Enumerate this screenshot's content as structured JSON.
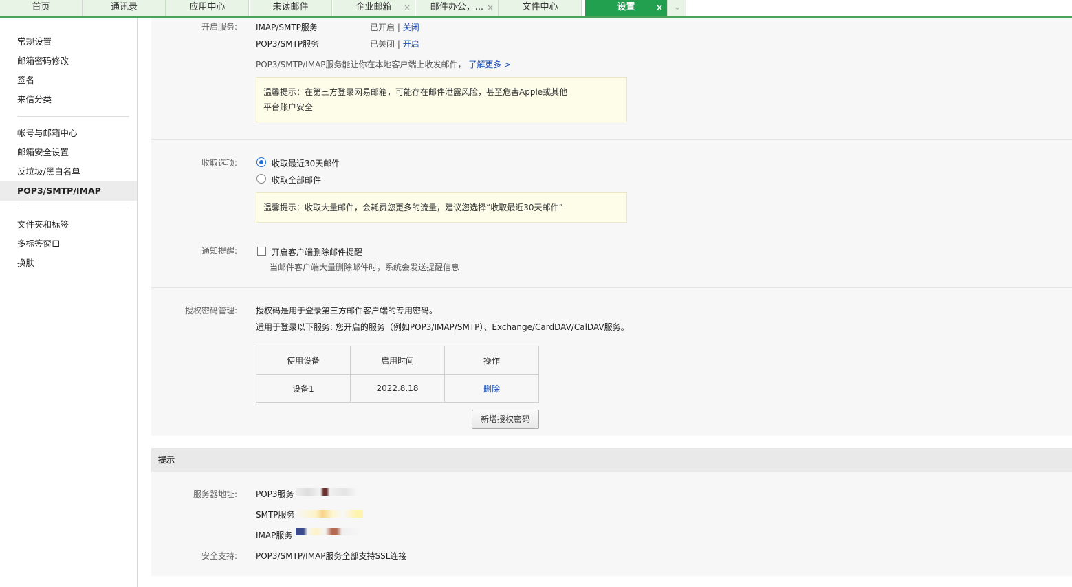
{
  "tabs": [
    {
      "label": "首页",
      "closable": false,
      "active": false
    },
    {
      "label": "通讯录",
      "closable": false,
      "active": false
    },
    {
      "label": "应用中心",
      "closable": false,
      "active": false
    },
    {
      "label": "未读邮件",
      "closable": false,
      "active": false
    },
    {
      "label": "企业邮箱",
      "closable": true,
      "active": false
    },
    {
      "label": "邮件办公，...",
      "closable": true,
      "active": false
    },
    {
      "label": "文件中心",
      "closable": false,
      "active": false
    },
    {
      "label": "设置",
      "closable": true,
      "active": true
    }
  ],
  "tab_close_glyph": "×",
  "tab_more_glyph": "⌄",
  "sidebar": {
    "groups": [
      [
        "常规设置",
        "邮箱密码修改",
        "签名",
        "来信分类"
      ],
      [
        "帐号与邮箱中心",
        "邮箱安全设置",
        "反垃圾/黑白名单",
        "POP3/SMTP/IMAP"
      ],
      [
        "文件夹和标签",
        "多标签窗口",
        "换肤"
      ]
    ],
    "active": "POP3/SMTP/IMAP"
  },
  "services": {
    "label": "开启服务:",
    "rows": [
      {
        "name": "IMAP/SMTP服务",
        "status": "已开启",
        "sep": "|",
        "action": "关闭"
      },
      {
        "name": "POP3/SMTP服务",
        "status": "已关闭",
        "sep": "|",
        "action": "开启"
      }
    ],
    "note": "POP3/SMTP/IMAP服务能让你在本地客户端上收发邮件，",
    "learn_more": "了解更多 >",
    "tip": "温馨提示：在第三方登录网易邮箱，可能存在邮件泄露风险，甚至危害Apple或其他平台账户安全"
  },
  "receive": {
    "label": "收取选项:",
    "options": [
      "收取最近30天邮件",
      "收取全部邮件"
    ],
    "selected": 0,
    "tip": "温馨提示：收取大量邮件，会耗费您更多的流量，建议您选择“收取最近30天邮件”"
  },
  "notify": {
    "label": "通知提醒:",
    "checkbox_label": "开启客户端删除邮件提醒",
    "checked": false,
    "desc": "当邮件客户端大量删除邮件时，系统会发送提醒信息"
  },
  "auth": {
    "label": "授权密码管理:",
    "line1": "授权码是用于登录第三方邮件客户端的专用密码。",
    "line2": "适用于登录以下服务: 您开启的服务（例如POP3/IMAP/SMTP）、Exchange/CardDAV/CalDAV服务。",
    "table": {
      "headers": [
        "使用设备",
        "启用时间",
        "操作"
      ],
      "rows": [
        [
          "设备1",
          "2022.8.18",
          "删除"
        ]
      ]
    },
    "add_button": "新增授权密码"
  },
  "hint": {
    "title": "提示",
    "server_label": "服务器地址:",
    "servers": [
      "POP3服务",
      "SMTP服务",
      "IMAP服务"
    ],
    "security_label": "安全支持:",
    "security_text": "POP3/SMTP/IMAP服务全部支持SSL连接"
  },
  "colors": {
    "accent_green": "#22a04f",
    "tab_bg": "#e8f4e6",
    "link_blue": "#1a4fb6",
    "radio_blue": "#1e6fd9",
    "tip_bg": "#fdfdea"
  }
}
